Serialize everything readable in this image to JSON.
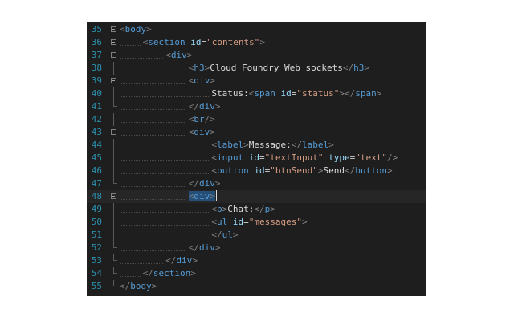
{
  "editor": {
    "lines": [
      {
        "n": "35",
        "fold": "start",
        "indent": 0,
        "tokens": [
          {
            "k": "punc",
            "t": "<"
          },
          {
            "k": "tag",
            "t": "body"
          },
          {
            "k": "punc",
            "t": ">"
          }
        ]
      },
      {
        "n": "36",
        "fold": "start",
        "indent": 1,
        "tokens": [
          {
            "k": "punc",
            "t": "<"
          },
          {
            "k": "tag",
            "t": "section"
          },
          {
            "k": "txt",
            "t": " "
          },
          {
            "k": "attr",
            "t": "id"
          },
          {
            "k": "eq",
            "t": "="
          },
          {
            "k": "val",
            "t": "\"contents\""
          },
          {
            "k": "punc",
            "t": ">"
          }
        ]
      },
      {
        "n": "37",
        "fold": "start",
        "indent": 2,
        "tokens": [
          {
            "k": "punc",
            "t": "<"
          },
          {
            "k": "tag",
            "t": "div"
          },
          {
            "k": "punc",
            "t": ">"
          }
        ]
      },
      {
        "n": "38",
        "fold": "bar",
        "indent": 3,
        "tokens": [
          {
            "k": "punc",
            "t": "<"
          },
          {
            "k": "tag",
            "t": "h3"
          },
          {
            "k": "punc",
            "t": ">"
          },
          {
            "k": "txt",
            "t": "Cloud Foundry Web sockets"
          },
          {
            "k": "punc",
            "t": "</"
          },
          {
            "k": "tag",
            "t": "h3"
          },
          {
            "k": "punc",
            "t": ">"
          }
        ]
      },
      {
        "n": "39",
        "fold": "start",
        "indent": 3,
        "tokens": [
          {
            "k": "punc",
            "t": "<"
          },
          {
            "k": "tag",
            "t": "div"
          },
          {
            "k": "punc",
            "t": ">"
          }
        ]
      },
      {
        "n": "40",
        "fold": "bar",
        "indent": 4,
        "tokens": [
          {
            "k": "txt",
            "t": "Status:"
          },
          {
            "k": "punc",
            "t": "<"
          },
          {
            "k": "tag",
            "t": "span"
          },
          {
            "k": "txt",
            "t": " "
          },
          {
            "k": "attr",
            "t": "id"
          },
          {
            "k": "eq",
            "t": "="
          },
          {
            "k": "val",
            "t": "\"status\""
          },
          {
            "k": "punc",
            "t": "></"
          },
          {
            "k": "tag",
            "t": "span"
          },
          {
            "k": "punc",
            "t": ">"
          }
        ]
      },
      {
        "n": "41",
        "fold": "end",
        "indent": 3,
        "tokens": [
          {
            "k": "punc",
            "t": "</"
          },
          {
            "k": "tag",
            "t": "div"
          },
          {
            "k": "punc",
            "t": ">"
          }
        ]
      },
      {
        "n": "42",
        "fold": "bar",
        "indent": 3,
        "tokens": [
          {
            "k": "punc",
            "t": "<"
          },
          {
            "k": "tag",
            "t": "br"
          },
          {
            "k": "punc",
            "t": "/>"
          }
        ]
      },
      {
        "n": "43",
        "fold": "start",
        "indent": 3,
        "tokens": [
          {
            "k": "punc",
            "t": "<"
          },
          {
            "k": "tag",
            "t": "div"
          },
          {
            "k": "punc",
            "t": ">"
          }
        ]
      },
      {
        "n": "44",
        "fold": "bar",
        "indent": 4,
        "tokens": [
          {
            "k": "punc",
            "t": "<"
          },
          {
            "k": "tag",
            "t": "label"
          },
          {
            "k": "punc",
            "t": ">"
          },
          {
            "k": "txt",
            "t": "Message:"
          },
          {
            "k": "punc",
            "t": "</"
          },
          {
            "k": "tag",
            "t": "label"
          },
          {
            "k": "punc",
            "t": ">"
          }
        ]
      },
      {
        "n": "45",
        "fold": "bar",
        "indent": 4,
        "tokens": [
          {
            "k": "punc",
            "t": "<"
          },
          {
            "k": "tag",
            "t": "input"
          },
          {
            "k": "txt",
            "t": " "
          },
          {
            "k": "attr",
            "t": "id"
          },
          {
            "k": "eq",
            "t": "="
          },
          {
            "k": "val",
            "t": "\"textInput\""
          },
          {
            "k": "txt",
            "t": " "
          },
          {
            "k": "attr",
            "t": "type"
          },
          {
            "k": "eq",
            "t": "="
          },
          {
            "k": "val",
            "t": "\"text\""
          },
          {
            "k": "punc",
            "t": "/>"
          }
        ]
      },
      {
        "n": "46",
        "fold": "bar",
        "indent": 4,
        "tokens": [
          {
            "k": "punc",
            "t": "<"
          },
          {
            "k": "tag",
            "t": "button"
          },
          {
            "k": "txt",
            "t": " "
          },
          {
            "k": "attr",
            "t": "id"
          },
          {
            "k": "eq",
            "t": "="
          },
          {
            "k": "val",
            "t": "\"btnSend\""
          },
          {
            "k": "punc",
            "t": ">"
          },
          {
            "k": "txt",
            "t": "Send"
          },
          {
            "k": "punc",
            "t": "</"
          },
          {
            "k": "tag",
            "t": "button"
          },
          {
            "k": "punc",
            "t": ">"
          }
        ]
      },
      {
        "n": "47",
        "fold": "end",
        "indent": 3,
        "tokens": [
          {
            "k": "punc",
            "t": "</"
          },
          {
            "k": "tag",
            "t": "div"
          },
          {
            "k": "punc",
            "t": ">"
          }
        ]
      },
      {
        "n": "48",
        "fold": "start",
        "indent": 3,
        "current": true,
        "tokens": [
          {
            "k": "punc hl",
            "t": "<"
          },
          {
            "k": "tag hl",
            "t": "div"
          },
          {
            "k": "punc hl",
            "t": ">"
          },
          {
            "k": "caret",
            "t": ""
          }
        ]
      },
      {
        "n": "49",
        "fold": "bar",
        "indent": 4,
        "tokens": [
          {
            "k": "punc",
            "t": "<"
          },
          {
            "k": "tag",
            "t": "p"
          },
          {
            "k": "punc",
            "t": ">"
          },
          {
            "k": "txt",
            "t": "Chat:"
          },
          {
            "k": "punc",
            "t": "</"
          },
          {
            "k": "tag",
            "t": "p"
          },
          {
            "k": "punc",
            "t": ">"
          }
        ]
      },
      {
        "n": "50",
        "fold": "bar",
        "indent": 4,
        "tokens": [
          {
            "k": "punc",
            "t": "<"
          },
          {
            "k": "tag",
            "t": "ul"
          },
          {
            "k": "txt",
            "t": " "
          },
          {
            "k": "attr",
            "t": "id"
          },
          {
            "k": "eq",
            "t": "="
          },
          {
            "k": "val",
            "t": "\"messages\""
          },
          {
            "k": "punc",
            "t": ">"
          }
        ]
      },
      {
        "n": "51",
        "fold": "bar",
        "indent": 4,
        "tokens": [
          {
            "k": "punc",
            "t": "</"
          },
          {
            "k": "tag",
            "t": "ul"
          },
          {
            "k": "punc",
            "t": ">"
          }
        ]
      },
      {
        "n": "52",
        "fold": "end",
        "indent": 3,
        "tokens": [
          {
            "k": "punc",
            "t": "</"
          },
          {
            "k": "tag",
            "t": "div"
          },
          {
            "k": "punc",
            "t": ">"
          }
        ]
      },
      {
        "n": "53",
        "fold": "end",
        "indent": 2,
        "tokens": [
          {
            "k": "punc",
            "t": "</"
          },
          {
            "k": "tag",
            "t": "div"
          },
          {
            "k": "punc",
            "t": ">"
          }
        ]
      },
      {
        "n": "54",
        "fold": "end",
        "indent": 1,
        "tokens": [
          {
            "k": "punc",
            "t": "</"
          },
          {
            "k": "tag",
            "t": "section"
          },
          {
            "k": "punc",
            "t": ">"
          }
        ]
      },
      {
        "n": "55",
        "fold": "end",
        "indent": 0,
        "tokens": [
          {
            "k": "punc",
            "t": "</"
          },
          {
            "k": "tag",
            "t": "body"
          },
          {
            "k": "punc",
            "t": ">"
          }
        ]
      }
    ]
  },
  "colors": {
    "background": "#1e1e1e",
    "line_number": "#2b91af",
    "tag": "#569cd6",
    "attribute": "#9cdcfe",
    "string": "#d69d85",
    "text": "#dcdcdc",
    "punctuation": "#808080",
    "selection": "#264f78"
  },
  "icons": [
    "fold-collapse-icon",
    "fold-guide-line"
  ]
}
